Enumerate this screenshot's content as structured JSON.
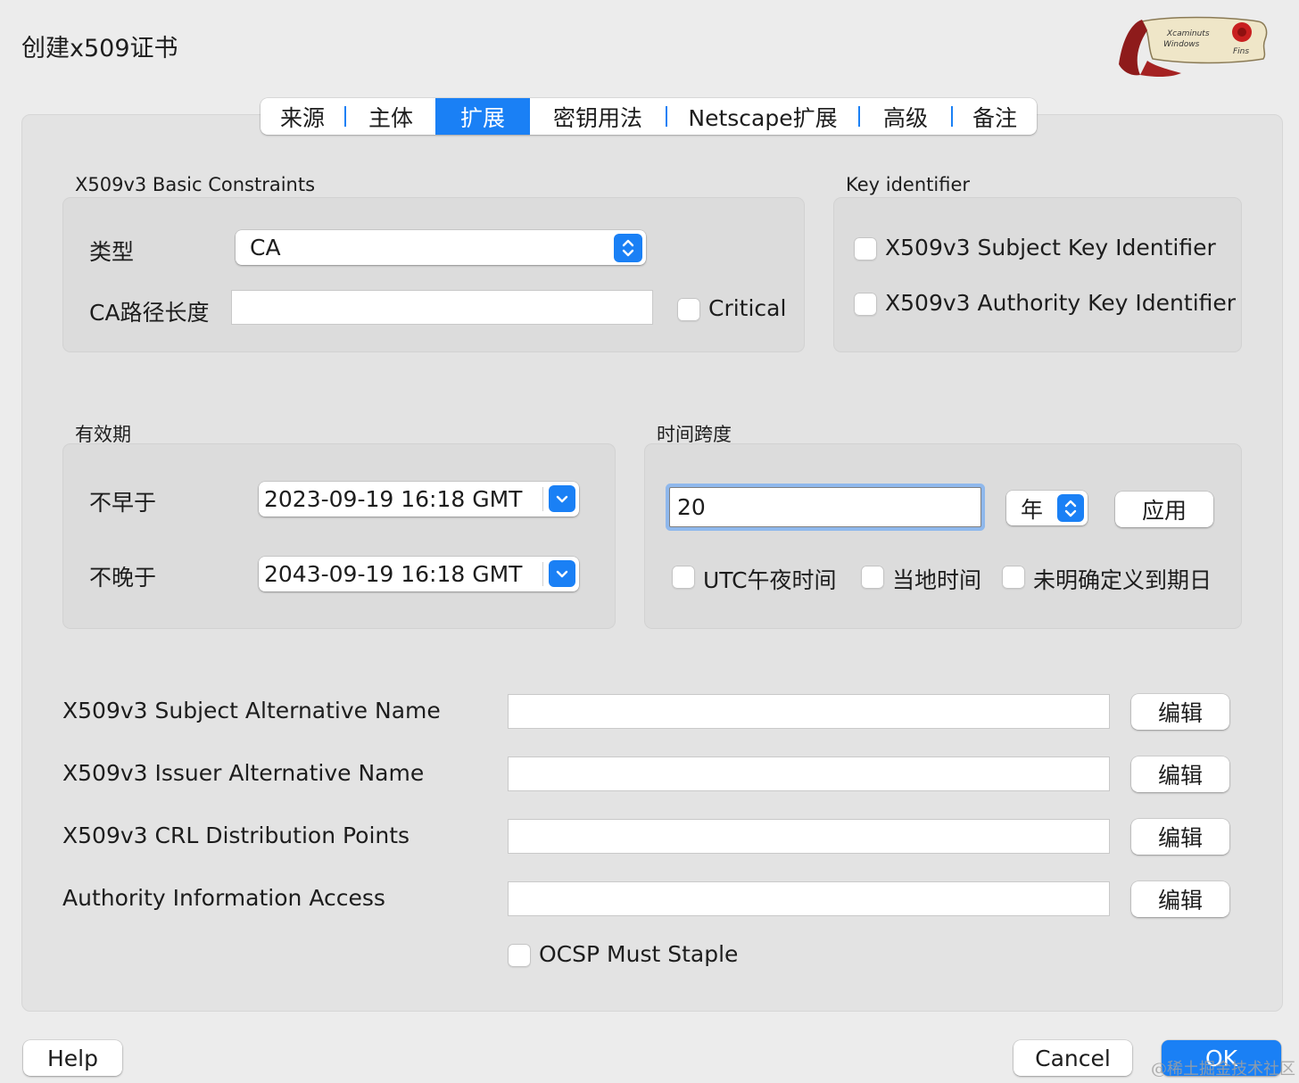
{
  "window": {
    "title": "创建x509证书"
  },
  "tabs": [
    {
      "label": "来源",
      "active": false
    },
    {
      "label": "主体",
      "active": false
    },
    {
      "label": "扩展",
      "active": true
    },
    {
      "label": "密钥用法",
      "active": false
    },
    {
      "label": "Netscape扩展",
      "active": false
    },
    {
      "label": "高级",
      "active": false
    },
    {
      "label": "备注",
      "active": false
    }
  ],
  "basic_constraints": {
    "title": "X509v3 Basic Constraints",
    "type_label": "类型",
    "type_value": "CA",
    "path_len_label": "CA路径长度",
    "path_len_value": "",
    "critical_label": "Critical",
    "critical_checked": false
  },
  "key_identifier": {
    "title": "Key identifier",
    "subject_label": "X509v3 Subject Key Identifier",
    "subject_checked": false,
    "authority_label": "X509v3 Authority Key Identifier",
    "authority_checked": false
  },
  "validity": {
    "title": "有效期",
    "not_before_label": "不早于",
    "not_before_value": "2023-09-19 16:18 GMT",
    "not_after_label": "不晚于",
    "not_after_value": "2043-09-19 16:18 GMT"
  },
  "time_range": {
    "title": "时间跨度",
    "value": "20",
    "unit": "年",
    "apply_label": "应用",
    "utc_midnight_label": "UTC午夜时间",
    "local_time_label": "当地时间",
    "undefined_expiry_label": "未明确定义到期日"
  },
  "extensions": [
    {
      "label": "X509v3 Subject Alternative Name",
      "value": "",
      "edit_label": "编辑"
    },
    {
      "label": "X509v3 Issuer Alternative Name",
      "value": "",
      "edit_label": "编辑"
    },
    {
      "label": "X509v3 CRL Distribution Points",
      "value": "",
      "edit_label": "编辑"
    },
    {
      "label": "Authority Information Access",
      "value": "",
      "edit_label": "编辑"
    }
  ],
  "ocsp": {
    "label": "OCSP Must Staple",
    "checked": false
  },
  "footer": {
    "help_label": "Help",
    "cancel_label": "Cancel",
    "ok_label": "OK"
  },
  "watermark": "@稀土掘金技术社区",
  "logo": {
    "text_line1": "Xcaminuts",
    "text_line2": "Windows",
    "text_line3": "Fins"
  },
  "colors": {
    "accent": "#1a80f5",
    "focus_ring": "#8fb8ec",
    "panel": "#e3e3e3",
    "background": "#ececec"
  },
  "icons": [
    "updown-chevron-icon",
    "chevron-down-icon",
    "scroll-logo-icon"
  ]
}
